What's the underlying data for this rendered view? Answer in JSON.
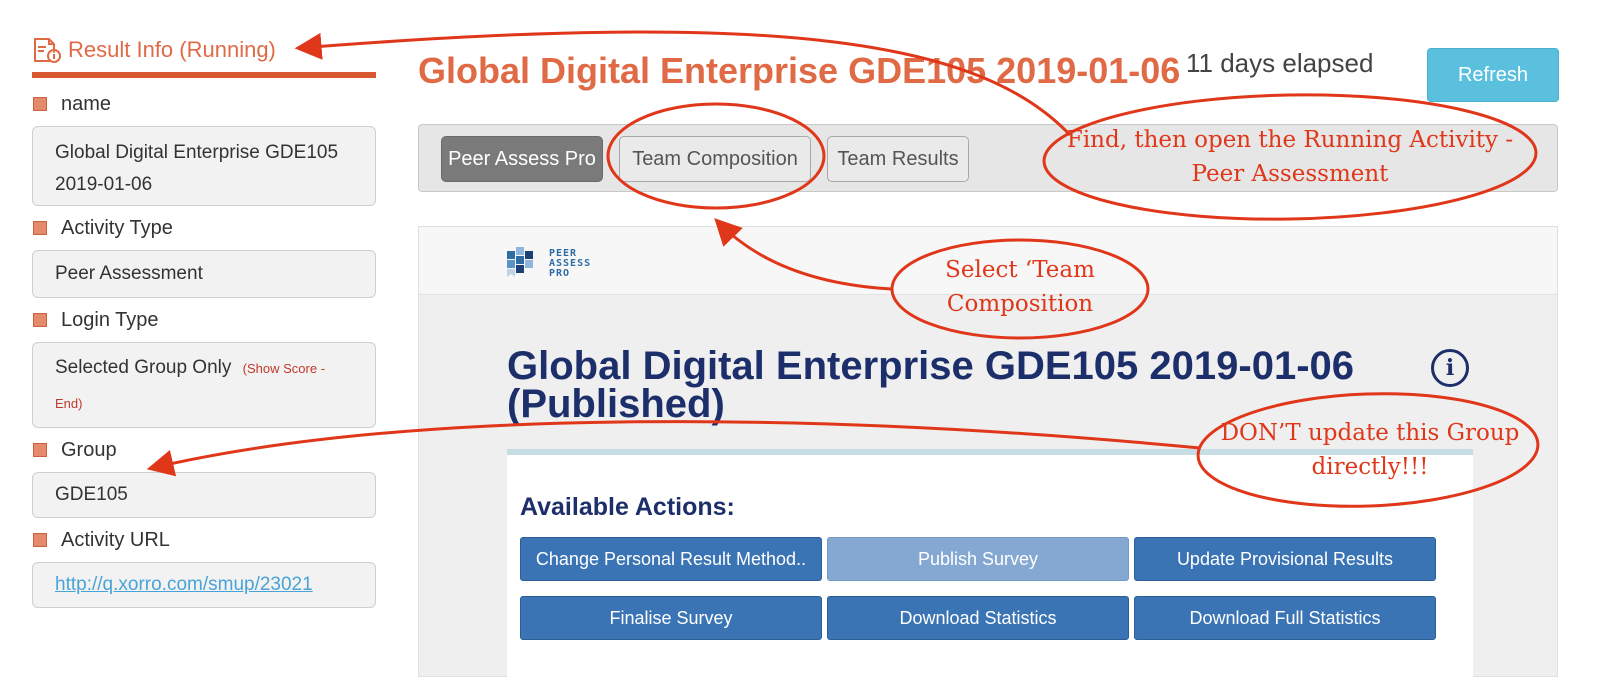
{
  "sidebar": {
    "header": "Result Info (Running)",
    "fields": [
      {
        "label": "name",
        "value": "Global Digital Enterprise GDE105 2019-01-06"
      },
      {
        "label": "Activity Type",
        "value": "Peer Assessment"
      },
      {
        "label": "Login Type",
        "value": "Selected Group Only",
        "extra": "(Show Score - End)"
      },
      {
        "label": "Group",
        "value": "GDE105"
      },
      {
        "label": "Activity URL",
        "value": "http://q.xorro.com/smup/23021"
      }
    ]
  },
  "header": {
    "title": "Global Digital Enterprise GDE105 2019-01-06",
    "elapsed": "11 days elapsed",
    "refresh_label": "Refresh"
  },
  "tabs": [
    {
      "label": "Peer Assess Pro",
      "active": true
    },
    {
      "label": "Team Composition",
      "active": false
    },
    {
      "label": "Team Results",
      "active": false
    }
  ],
  "panel": {
    "logo_lines": [
      "PEER",
      "ASSESS",
      "PRO"
    ],
    "title": "Global Digital Enterprise GDE105 2019-01-06 (Published)",
    "info_glyph": "i",
    "actions_title": "Available Actions:",
    "actions": [
      {
        "label": "Change Personal Result Method..",
        "disabled": false
      },
      {
        "label": "Publish Survey",
        "disabled": true
      },
      {
        "label": "Update Provisional Results",
        "disabled": false
      },
      {
        "label": "Finalise Survey",
        "disabled": false
      },
      {
        "label": "Download Statistics",
        "disabled": false
      },
      {
        "label": "Download Full Statistics",
        "disabled": false
      }
    ]
  },
  "annotations": {
    "note1": "Find, then open the Running Activity - Peer Assessment",
    "note2": "Select ‘Team Composition",
    "note3": "DON’T update this Group directly!!!"
  },
  "colors": {
    "accent_orange": "#e06a45",
    "annotation_red": "#e0371a",
    "action_blue": "#3a74b4",
    "refresh_blue": "#5bc0de",
    "title_navy": "#1d2f6b"
  }
}
